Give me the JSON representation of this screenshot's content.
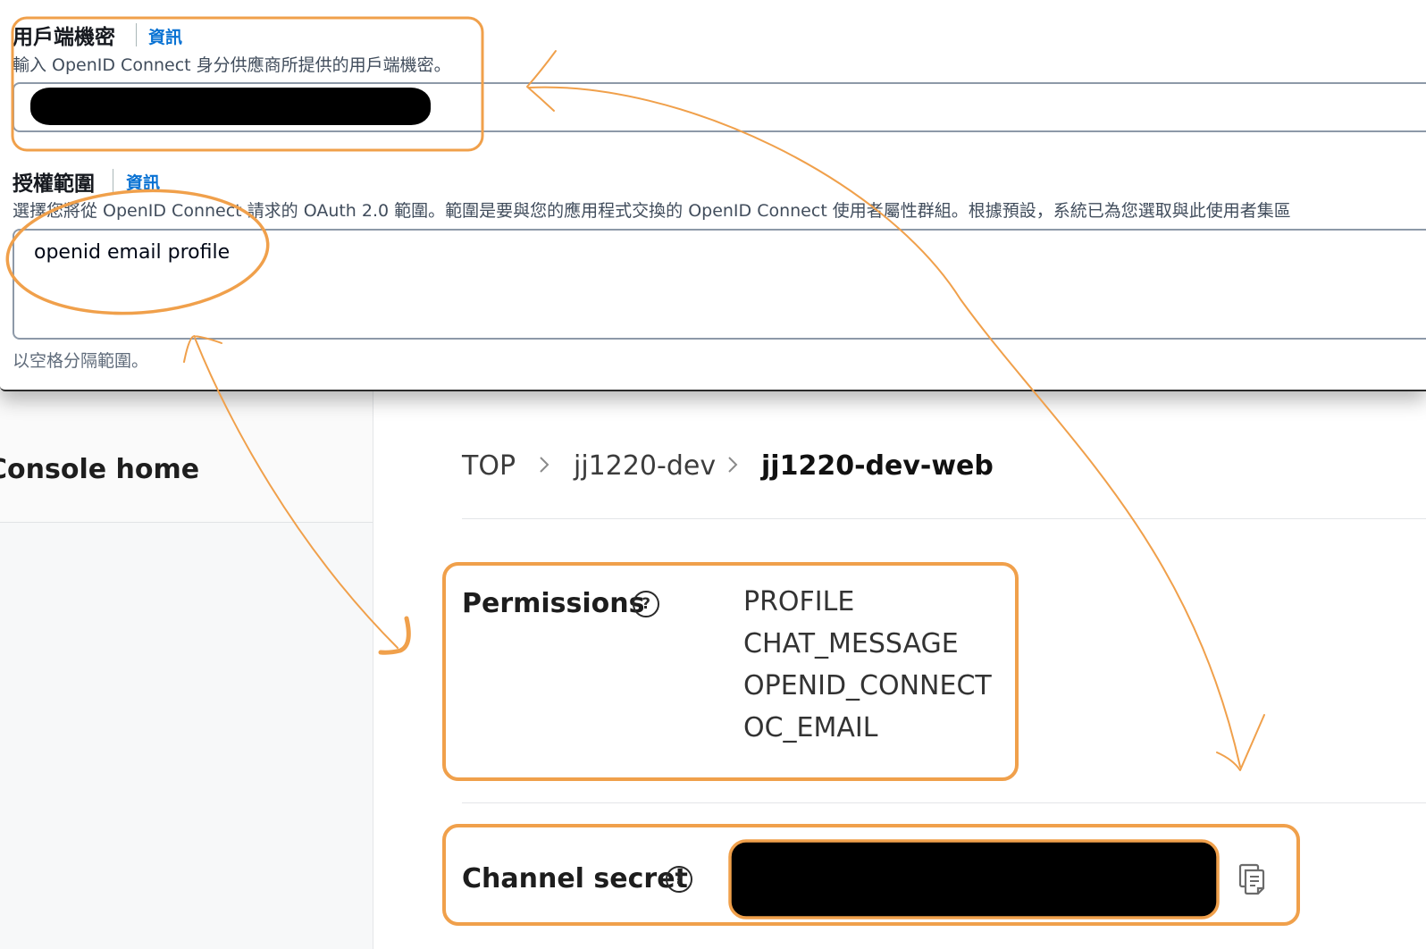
{
  "client_secret": {
    "label": "用戶端機密",
    "info": "資訊",
    "description": "輸入 OpenID Connect 身分供應商所提供的用戶端機密。"
  },
  "scopes": {
    "label": "授權範圍",
    "info": "資訊",
    "description": "選擇您將從 OpenID Connect 請求的 OAuth 2.0 範圍。範圍是要與您的應用程式交換的 OpenID Connect 使用者屬性群組。根據預設，系統已為您選取與此使用者集區",
    "value": "openid email profile",
    "hint": "以空格分隔範圍。"
  },
  "console": {
    "nav_title": "Console home",
    "breadcrumb": [
      "TOP",
      "jj1220-dev",
      "jj1220-dev-web"
    ],
    "permissions_label": "Permissions",
    "permissions": [
      "PROFILE",
      "CHAT_MESSAGE",
      "OPENID_CONNECT",
      "OC_EMAIL"
    ],
    "channel_secret_label": "Channel secret",
    "help_symbol": "?"
  },
  "annotation_color": "#F0A04B",
  "icons": [
    "help-circle-icon",
    "chevron-right-icon",
    "copy-icon"
  ]
}
